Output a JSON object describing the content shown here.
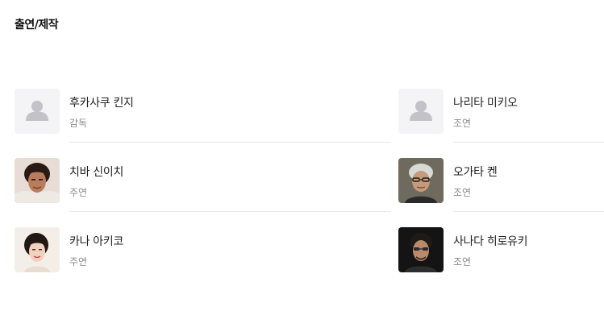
{
  "section": {
    "title": "출연/제작"
  },
  "cast": {
    "left": [
      {
        "name": "후카사쿠 킨지",
        "role": "감독",
        "avatar": "placeholder-person-icon"
      },
      {
        "name": "치바 신이치",
        "role": "주연",
        "avatar": "photo"
      },
      {
        "name": "카나 아키코",
        "role": "주연",
        "avatar": "photo"
      }
    ],
    "right": [
      {
        "name": "나리타 미키오",
        "role": "조연",
        "avatar": "placeholder-person-icon"
      },
      {
        "name": "오가타 켄",
        "role": "조연",
        "avatar": "photo"
      },
      {
        "name": "사나다 히로유키",
        "role": "조연",
        "avatar": "photo"
      }
    ]
  },
  "colors": {
    "placeholder_bg": "#f4f4f6",
    "placeholder_icon": "#c2c2c8",
    "divider": "#e9e9e9",
    "role_text": "#8a8a8a"
  }
}
